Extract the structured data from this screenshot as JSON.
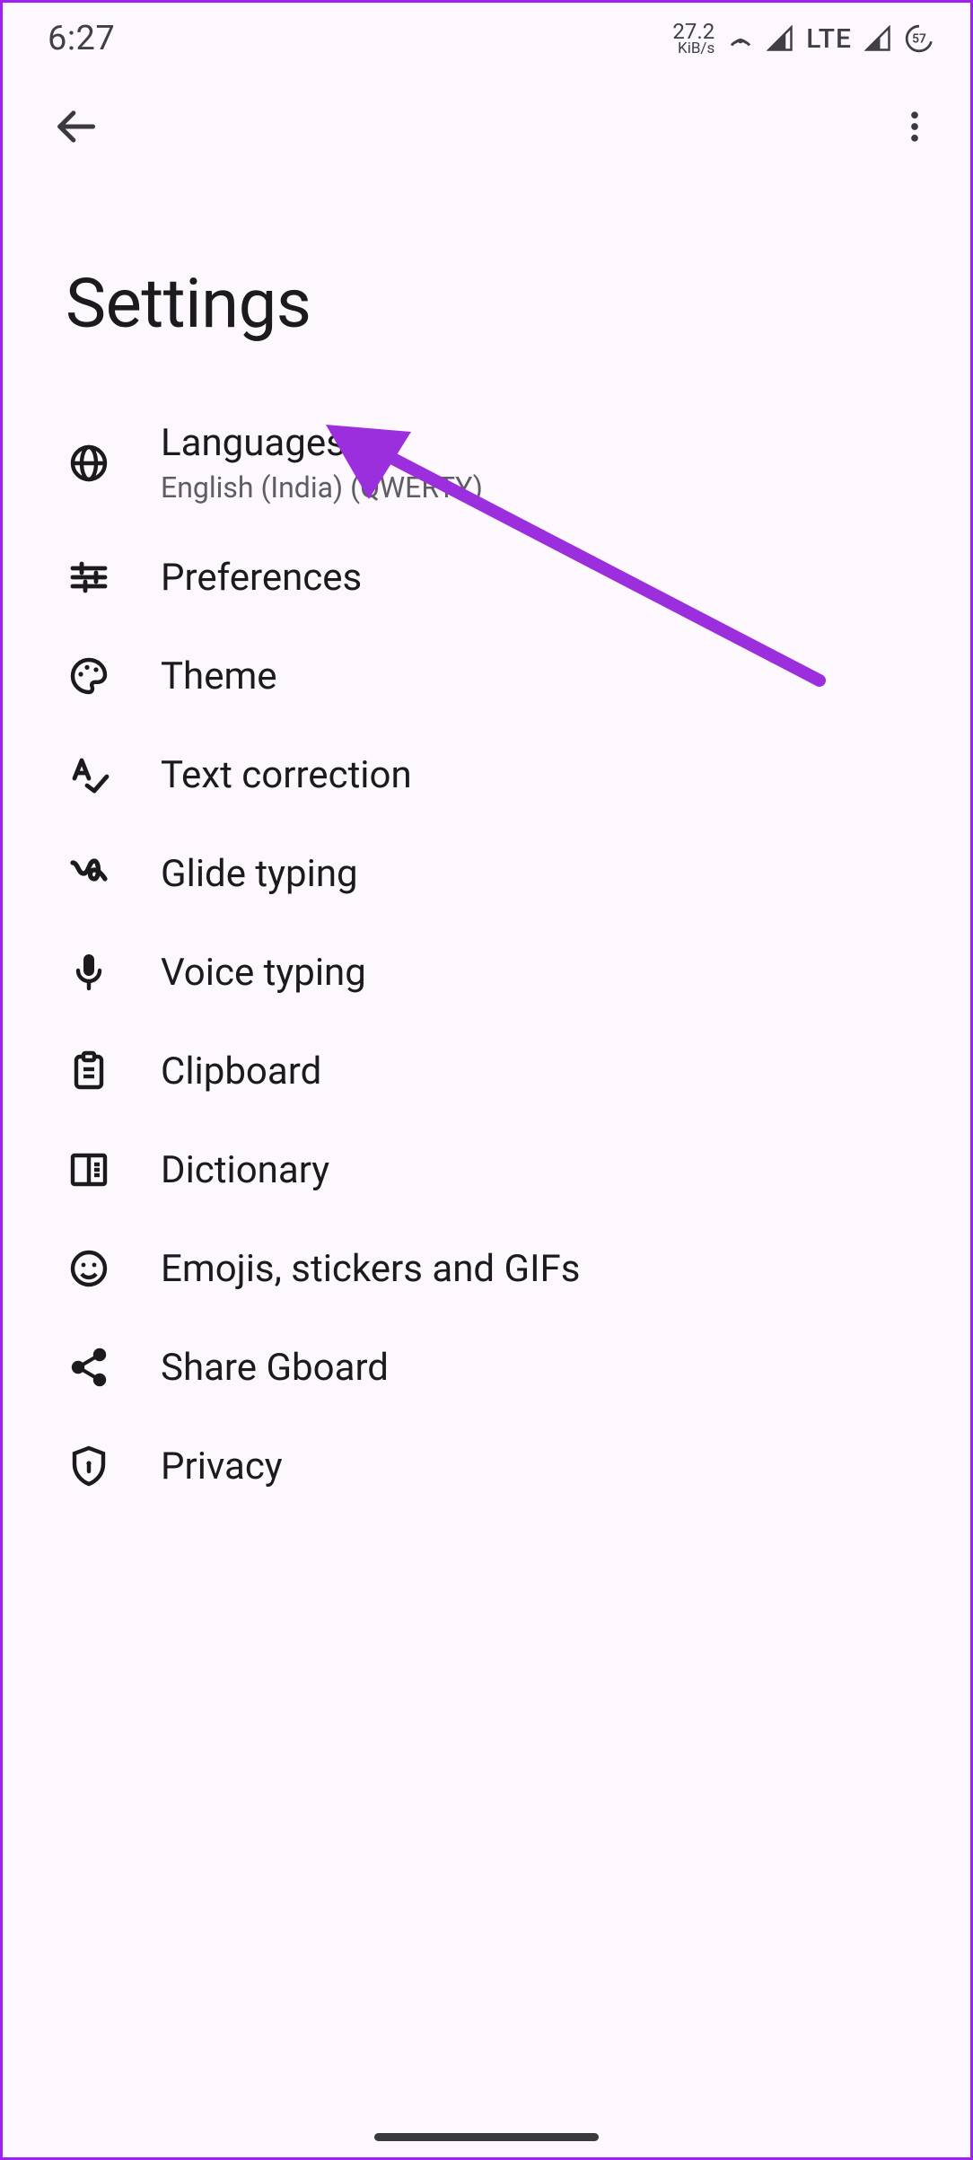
{
  "status": {
    "time": "6:27",
    "net_value": "27.2",
    "net_unit": "KiB/s",
    "network_label": "LTE",
    "battery": "57"
  },
  "page": {
    "title": "Settings"
  },
  "items": [
    {
      "title": "Languages",
      "subtitle": "English (India) (QWERTY)"
    },
    {
      "title": "Preferences"
    },
    {
      "title": "Theme"
    },
    {
      "title": "Text correction"
    },
    {
      "title": "Glide typing"
    },
    {
      "title": "Voice typing"
    },
    {
      "title": "Clipboard"
    },
    {
      "title": "Dictionary"
    },
    {
      "title": "Emojis, stickers and GIFs"
    },
    {
      "title": "Share Gboard"
    },
    {
      "title": "Privacy"
    }
  ]
}
